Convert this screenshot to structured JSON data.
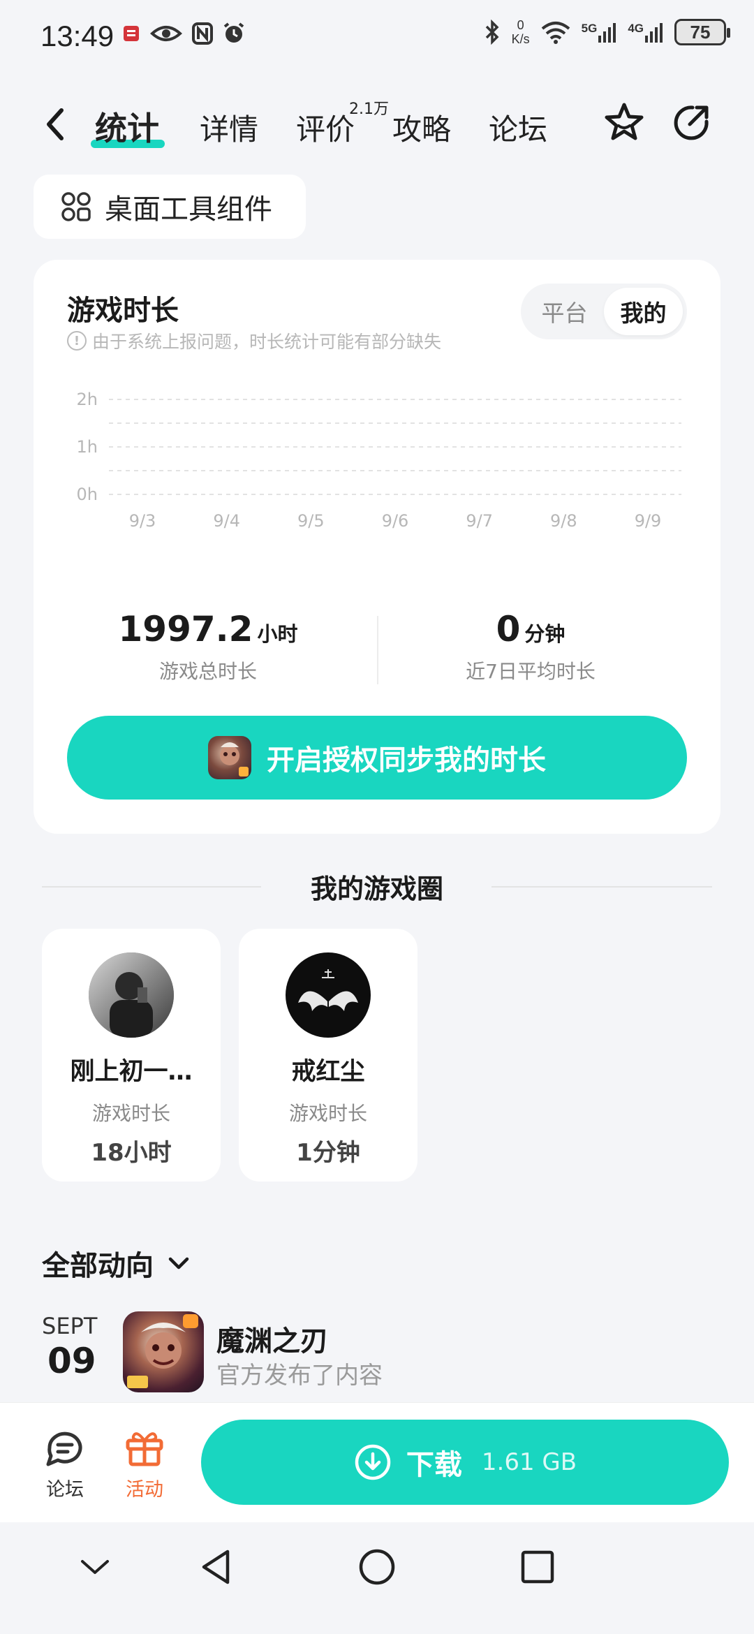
{
  "status_bar": {
    "time": "13:49",
    "net_speed_value": "0",
    "net_speed_unit": "K/s",
    "signal_5g": "5G",
    "signal_4g": "4G",
    "battery": "75"
  },
  "nav": {
    "tabs": [
      {
        "label": "统计",
        "active": true
      },
      {
        "label": "详情"
      },
      {
        "label": "评价",
        "badge": "2.1万"
      },
      {
        "label": "攻略"
      },
      {
        "label": "论坛"
      }
    ]
  },
  "widget_chip": {
    "label": "桌面工具组件"
  },
  "playtime_card": {
    "title": "游戏时长",
    "hint": "由于系统上报问题，时长统计可能有部分缺失",
    "segment": [
      "平台",
      "我的"
    ],
    "selected_segment": "我的",
    "stats": [
      {
        "value": "1997.2",
        "unit": "小时",
        "label": "游戏总时长"
      },
      {
        "value": "0",
        "unit": "分钟",
        "label": "近7日平均时长"
      }
    ],
    "cta_label": "开启授权同步我的时长"
  },
  "chart_data": {
    "type": "line",
    "x": [
      "9/3",
      "9/4",
      "9/5",
      "9/6",
      "9/7",
      "9/8",
      "9/9"
    ],
    "y_ticks": [
      "2h",
      "1h",
      "0h"
    ],
    "series": [
      {
        "values": [
          0,
          0,
          0,
          0,
          0,
          0,
          0
        ]
      }
    ],
    "ylim": [
      0,
      2
    ],
    "grid": true
  },
  "game_circle": {
    "title": "我的游戏圈",
    "friends": [
      {
        "name": "刚上初一…",
        "label": "游戏时长",
        "value": "18小时"
      },
      {
        "name": "戒红尘",
        "label": "游戏时长",
        "value": "1分钟"
      }
    ]
  },
  "activity": {
    "filter_label": "全部动向",
    "items": [
      {
        "month": "SEPT",
        "day": "09",
        "title": "魔渊之刃",
        "subtitle": "官方发布了内容"
      }
    ]
  },
  "bottom_bar": {
    "forum_label": "论坛",
    "event_label": "活动",
    "download_label": "下载",
    "download_size": "1.61 GB",
    "accent": "#19d6c0",
    "event_color": "#f26b35"
  }
}
